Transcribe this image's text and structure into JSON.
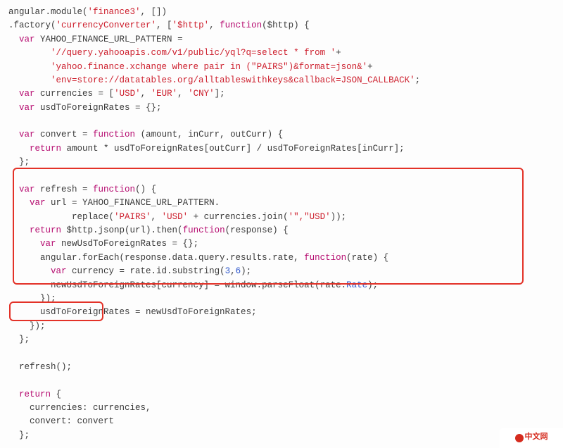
{
  "code": {
    "l01a": "angular.module(",
    "l01s": "'finance3'",
    "l01b": ", [])",
    "l02a": ".factory(",
    "l02s1": "'currencyConverter'",
    "l02b": ", [",
    "l02s2": "'$http'",
    "l02c": ", ",
    "l02k": "function",
    "l02d": "($http) {",
    "l03k": "var",
    "l03a": " YAHOO_FINANCE_URL_PATTERN =",
    "l04s": "'//query.yahooapis.com/v1/public/yql?q=select * from '",
    "l04a": "+",
    "l05s": "'yahoo.finance.xchange where pair in (\"PAIRS\")&format=json&'",
    "l05a": "+",
    "l06s": "'env=store://datatables.org/alltableswithkeys&callback=JSON_CALLBACK'",
    "l06a": ";",
    "l07k": "var",
    "l07a": " currencies = [",
    "l07s1": "'USD'",
    "l07b": ", ",
    "l07s2": "'EUR'",
    "l07c": ", ",
    "l07s3": "'CNY'",
    "l07d": "];",
    "l08k": "var",
    "l08a": " usdToForeignRates = {};",
    "l10k": "var",
    "l10a": " convert = ",
    "l10k2": "function",
    "l10b": " (amount, inCurr, outCurr) {",
    "l11k": "return",
    "l11a": " amount * usdToForeignRates[outCurr] / usdToForeignRates[inCurr];",
    "l12a": "};",
    "l14k": "var",
    "l14a": " refresh = ",
    "l14k2": "function",
    "l14b": "() {",
    "l15k": "var",
    "l15a": " url = YAHOO_FINANCE_URL_PATTERN.",
    "l16a": "replace(",
    "l16s1": "'PAIRS'",
    "l16b": ", ",
    "l16s2": "'USD'",
    "l16c": " + currencies.join(",
    "l16s3": "'\",\"USD'",
    "l16d": "));",
    "l17k": "return",
    "l17a": " $http.jsonp(url).then(",
    "l17k2": "function",
    "l17b": "(response) {",
    "l18k": "var",
    "l18a": " newUsdToForeignRates = {};",
    "l19a": "angular.forEach(response.data.query.results.rate, ",
    "l19k": "function",
    "l19b": "(rate) {",
    "l20k": "var",
    "l20a": " currency = rate.id.substring(",
    "l20n1": "3",
    "l20b": ",",
    "l20n2": "6",
    "l20c": ");",
    "l21a": "newUsdToForeignRates[currency] = window.parseFloat(rate.",
    "l21attr": "Rate",
    "l21b": ");",
    "l22a": "});",
    "l23a": "usdToForeignRates = newUsdToForeignRates;",
    "l24a": "});",
    "l25a": "};",
    "l27a": "refresh();",
    "l29k": "return",
    "l29a": " {",
    "l30a": "currencies: currencies,",
    "l31a": "convert: convert",
    "l32a": "};"
  },
  "logo": {
    "text": "中文网"
  }
}
